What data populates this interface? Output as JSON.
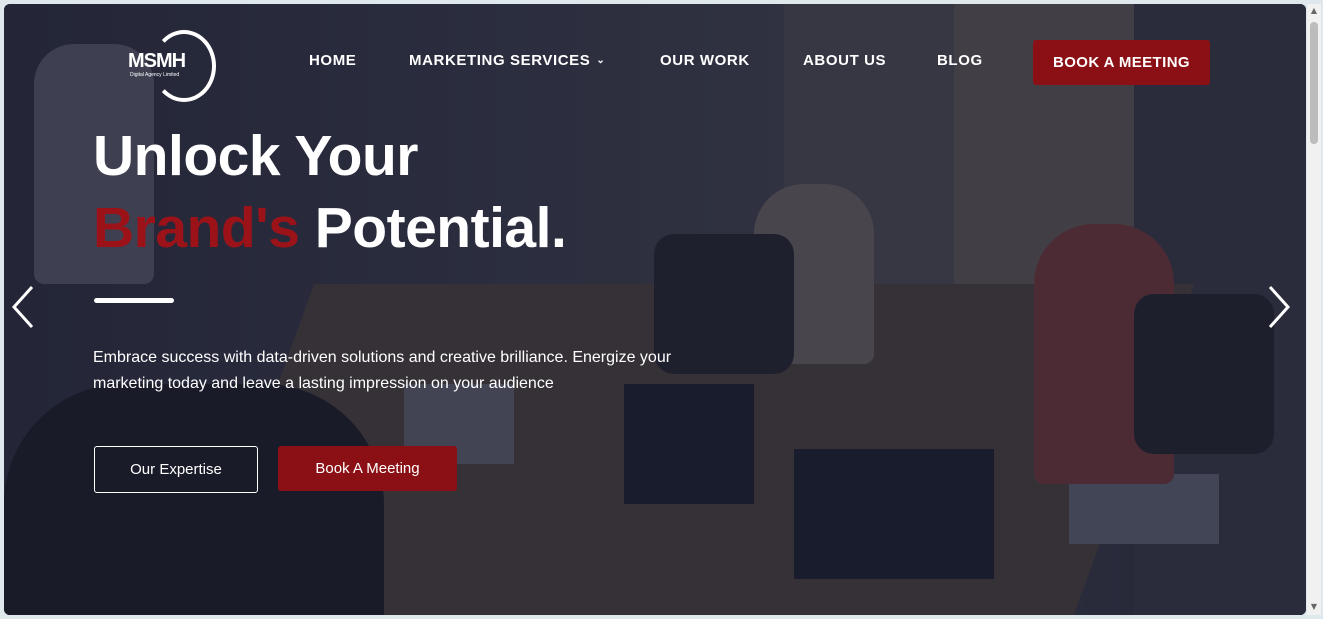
{
  "brand": {
    "logo_text": "MSMH",
    "logo_tagline": "Digital Agency Limited"
  },
  "nav": {
    "items": [
      {
        "label": "HOME"
      },
      {
        "label": "MARKETING SERVICES"
      },
      {
        "label": "OUR WORK"
      },
      {
        "label": "ABOUT US"
      },
      {
        "label": "BLOG"
      }
    ],
    "cta_label": "BOOK A MEETING"
  },
  "hero": {
    "headline_line1": "Unlock Your",
    "headline_accent": "Brand's",
    "headline_rest": "Potential.",
    "description": "Embrace success with data-driven solutions and creative brilliance. Energize your marketing today and leave a lasting impression on your audience",
    "primary_button": "Our Expertise",
    "secondary_button": "Book A Meeting"
  },
  "icons": {
    "prev": "chevron-left-icon",
    "next": "chevron-right-icon",
    "dropdown": "chevron-down-icon"
  },
  "colors": {
    "accent": "#8b1015",
    "text": "#ffffff",
    "overlay": "#16182a"
  }
}
